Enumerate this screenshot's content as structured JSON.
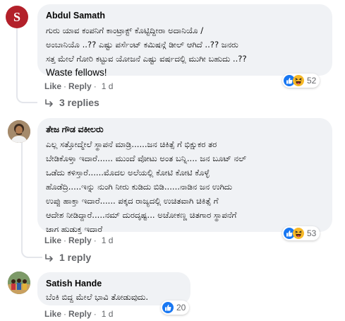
{
  "colors": {
    "bubble": "#f0f2f5",
    "meta": "#65676b",
    "like_blue": "#1877f2",
    "haha_yellow": "#f7b928"
  },
  "comments": [
    {
      "author": "Abdul Samath",
      "avatar_letter": "S",
      "text_lines": [
        "ಗುರು ಯಾವ ಕಂಪನಿಗೆ ಕಾಂಟ್ರಾಕ್ಟ್ ಕೊಟ್ಟಿದ್ದೀರಾ ಅದಾನಿಯೊ /",
        "ಅಂಬಾನಿಯೊ ..?? ಎಷ್ಟು ಪರ್ಸೆಂಟ್ ಕಮಿಷನ್ಗೆ ಡೀಲ್ ಆಗಿದೆ ..?? ಜನರು",
        "ಸತ್ತ ಮೇಲೆ ಗೋರಿ ಕಟ್ಟುವ ಯೋಜನೆ ಎಷ್ಟು ವರ್ಷದಲ್ಲಿ ಮುಗೀ ಬಹುದು ..??",
        "Waste fellows!"
      ],
      "reactions": [
        "like-icon",
        "haha-icon"
      ],
      "reaction_count": "52",
      "like_label": "Like",
      "reply_label": "Reply",
      "time": "1 d",
      "replies_label": "3 replies"
    },
    {
      "author": "ತೇಜ ಗೌಡ ವಕೀಲರು",
      "text_lines": [
        "ಎಲ್ಲ ಸತ್ತೋದ್ಮೇಲೆ ಸ್ಥಾಪನೆ ಮಾಡ್ರಿ......ಜನ ಚಿಕಿತ್ಸೆ ಗೆ ಭಿಕ್ಷುಕರ ತರ",
        "ಬೇಡಿಕೊಳ್ತಾ ಇದಾರೆ...... ಮುಂದೆ ವೋಟು ಅಂತ ಬನ್ನಿ.... ಜನ ಬೂಟ್ ನಲ್",
        "ಒಡೆದು ಕಳಿಸ್ತಾರೆ......ಮೊದಲ ಅಲೆಯಲ್ಲಿ ಕೋಟಿ ಕೋಟಿ ಕೊಳ್ಳೆ",
        "ಹೊಡೆದ್ರಿ.....ಇನ್ನು ನುಂಗಿ ನೀರು ಕುಡಿದು ಬಿಡಿ......ನಾಡಿನ ಜನ ಉಗಿದು",
        "ಉಪ್ಪು ಹಾಕ್ತಾ ಇದಾರೆ...... ಪಕ್ಕದ ರಾಜ್ಯದಲ್ಲಿ ಉಚಿತವಾಗಿ ಚಿಕಿತ್ಸೆ ಗೆ",
        "ಆದೇಶ ನೀಡಿದ್ದಾರೆ.....ನಮ್ ದುರದೃಷ್ಟ... ಅಚೋಕಣ್ಣ ಚಿತಗಾರ ಸ್ಥಾಪನೆಗೆ",
        "ಜಾಗ ಹುಡುಕ್ತ ಇದಾರೆ"
      ],
      "reactions": [
        "like-icon",
        "haha-icon"
      ],
      "reaction_count": "53",
      "like_label": "Like",
      "reply_label": "Reply",
      "time": "1 d",
      "replies_label": "1 reply"
    },
    {
      "author": "Satish Hande",
      "text_lines": [
        "ಬೆಂಕಿ ಬಿದ್ದ ಮೇಲೆ ಭಾವಿ ತೋಡುವುದು."
      ],
      "reactions": [
        "like-icon"
      ],
      "reaction_count": "20",
      "like_label": "Like",
      "reply_label": "Reply",
      "time": "1 d"
    }
  ]
}
